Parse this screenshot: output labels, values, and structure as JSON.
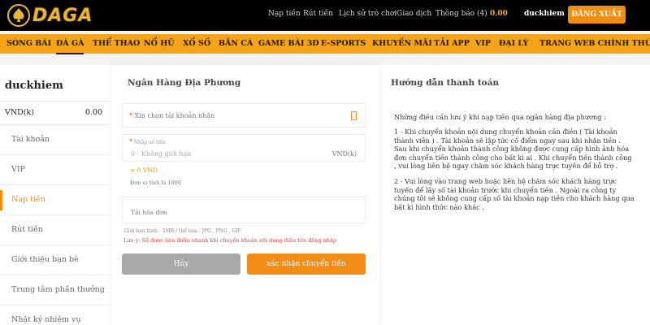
{
  "header": {
    "logo_text": "DAGA",
    "links": [
      "Nạp tiền",
      "Rút tiền",
      "Lịch sử trò chơi",
      "Giao dịch",
      "Thông báo (4)"
    ],
    "balance": "0.00",
    "username": "duckhiem",
    "logout_label": "ĐĂNG XUẤT"
  },
  "main_nav": {
    "items": [
      "SÒNG BÀI",
      "ĐÁ GÀ",
      "THỂ THAO",
      "NỔ HŨ",
      "XỔ SỐ",
      "BẮN CÁ",
      "GAME BÀI 3D",
      "E-SPORTS",
      "KHUYẾN MÃI",
      "TẢI APP",
      "VIP",
      "ĐẠI LÝ",
      "TRANG WEB CHÍNH THỨC"
    ],
    "active": "ĐÁ GÀ"
  },
  "sidebar": {
    "username": "duckhiem",
    "balance_label": "VND(k)",
    "balance_value": "0.00",
    "items": [
      "Tài khoản",
      "VIP",
      "Nạp tiền",
      "Rút tiền",
      "Giới thiệu bạn bè",
      "Trung tâm phần thưởng",
      "Nhật ký nhiệm vụ"
    ],
    "active": "Nạp tiền"
  },
  "form": {
    "title": "Ngân Hàng Địa Phương",
    "required_mark": "*",
    "account_select_placeholder": "Xin chọn tài khoản nhận",
    "amount_label": "Nhập số tiền",
    "amount_placeholder": "0 - Không giới hạn",
    "amount_unit": "VND(k)",
    "converted": "= 0 VND",
    "unit_note": "Đơn vị tính là 1000",
    "invoice_label": "Tải hóa đơn",
    "file_limits": "Giới hạn hình : 5MB / thể loại : JPG , PNG , GIF",
    "note": "Lưu ý: Số được liên điểm nhanh khi chuyển khoản nội dung điền tên đăng nhập",
    "cancel_label": "Hủy",
    "confirm_label": "xác nhận chuyển tiền"
  },
  "guide": {
    "title": "Hướng dẫn thanh toán",
    "intro": "Những điều cần lưu ý khi nạp tiền qua ngân hàng địa phương :",
    "p1": "1 - Khi chuyển khoản nội dung chuyển khoản cần điền ( Tài khoản thành viên ) . Tài khoản sẽ lập tức cố điểm ngay sau khi nhận tiền . Sau khi chuyển khoản thành công không được cung cấp hình ảnh hóa đơn chuyển tiền thành công cho bất kì ai . Khi chuyển tiền thành công , vui lòng liên hệ ngay chăm sóc khách hàng trực tuyến để hỗ trợ .",
    "p2": "2 - Vui lòng vào trang web hoặc liên hệ chăm sóc khách hàng trực tuyến để lấy số tài khoản trước khi chuyển tiền . Ngoài ra công ty chúng tôi sẽ không cung cấp số tài khoản nạp tiền cho khách hàng qua bất kì hình thức nào khác ."
  }
}
